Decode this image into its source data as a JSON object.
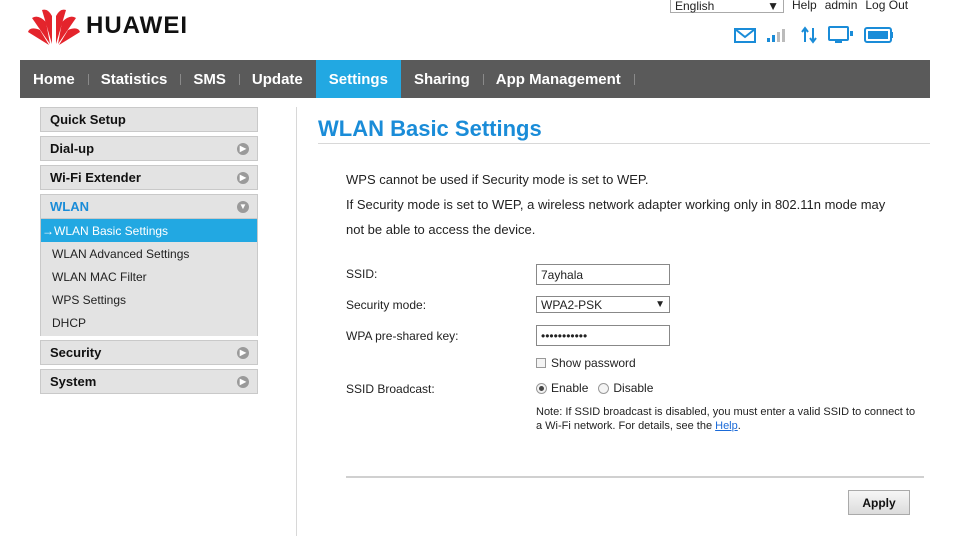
{
  "brand": {
    "name": "HUAWEI",
    "logo_color": "#e4242c"
  },
  "header": {
    "language": "English",
    "links": {
      "help": "Help",
      "user": "admin",
      "logout": "Log Out"
    },
    "status_icons": [
      "mail-icon",
      "signal-icon",
      "data-transfer-icon",
      "display-icon",
      "battery-icon"
    ]
  },
  "nav": {
    "items": [
      {
        "label": "Home"
      },
      {
        "label": "Statistics"
      },
      {
        "label": "SMS"
      },
      {
        "label": "Update"
      },
      {
        "label": "Settings",
        "active": true
      },
      {
        "label": "Sharing"
      },
      {
        "label": "App Management"
      }
    ],
    "accent": "#22a8e2"
  },
  "sidebar": {
    "quick_setup": "Quick Setup",
    "dialup": "Dial-up",
    "wifi_extender": "Wi-Fi Extender",
    "wlan": "WLAN",
    "wlan_items": [
      "→WLAN Basic Settings",
      "WLAN Advanced Settings",
      "WLAN MAC Filter",
      "WPS Settings",
      "DHCP"
    ],
    "security": "Security",
    "system": "System"
  },
  "main": {
    "title": "WLAN Basic Settings",
    "para1": "WPS cannot be used if Security mode is set to WEP.",
    "para2": "If Security mode is set to WEP, a wireless network adapter working only in 802.11n mode may",
    "para3": "not be able to access the device.",
    "ssid_label": "SSID:",
    "ssid_value": "7ayhala",
    "security_label": "Security mode:",
    "security_value": "WPA2-PSK",
    "key_label": "WPA pre-shared key:",
    "key_value": "•••••••••••",
    "show_password": "Show password",
    "broadcast_label": "SSID Broadcast:",
    "enable": "Enable",
    "disable": "Disable",
    "note": "Note: If SSID broadcast is disabled, you must enter a valid SSID to connect to a Wi-Fi network. For details, see the ",
    "help_link": "Help",
    "note_end": ".",
    "apply": "Apply"
  }
}
